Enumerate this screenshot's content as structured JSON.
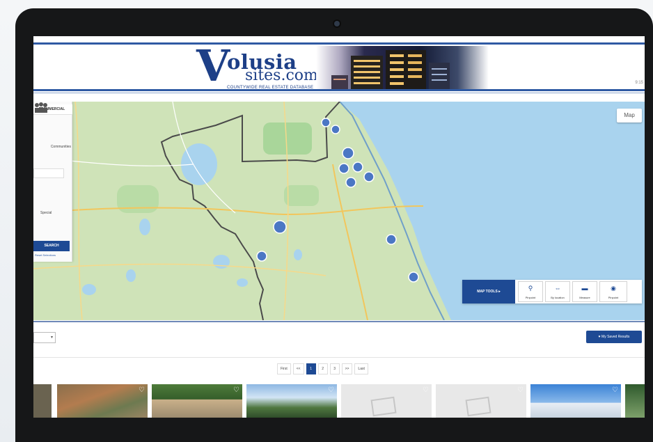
{
  "site": {
    "logo_initial": "V",
    "logo_word": "olusia",
    "logo_sub": "sites.com",
    "logo_tagline": "COUNTYWIDE REAL ESTATE DATABASE"
  },
  "header": {
    "right_text": "9:15"
  },
  "map": {
    "left_panel": {
      "tab_label": "COMMERCIAL",
      "community_label": "Communities",
      "field_label": "Special",
      "search_label": "SEARCH",
      "reset_label": "Reset Selections"
    },
    "map_type_label": "Map",
    "tools": {
      "label": "MAP TOOLS ▸",
      "buttons": [
        {
          "label": "Pinpoint",
          "icon": "pin-icon"
        },
        {
          "label": "By location",
          "icon": "location-icon"
        },
        {
          "label": "Measure",
          "icon": "ruler-icon"
        },
        {
          "label": "Pinpoint",
          "icon": "target-icon"
        }
      ]
    }
  },
  "results": {
    "sort_value": "▾",
    "saved_button": "♥ My Saved Results"
  },
  "pagination": {
    "items": [
      "First",
      "<<",
      "1",
      "2",
      "3",
      ">>",
      "Last"
    ],
    "active": "1"
  },
  "colors": {
    "brand_blue": "#1e4a94",
    "water": "#a9d3ee",
    "land": "#cfe3b8"
  }
}
